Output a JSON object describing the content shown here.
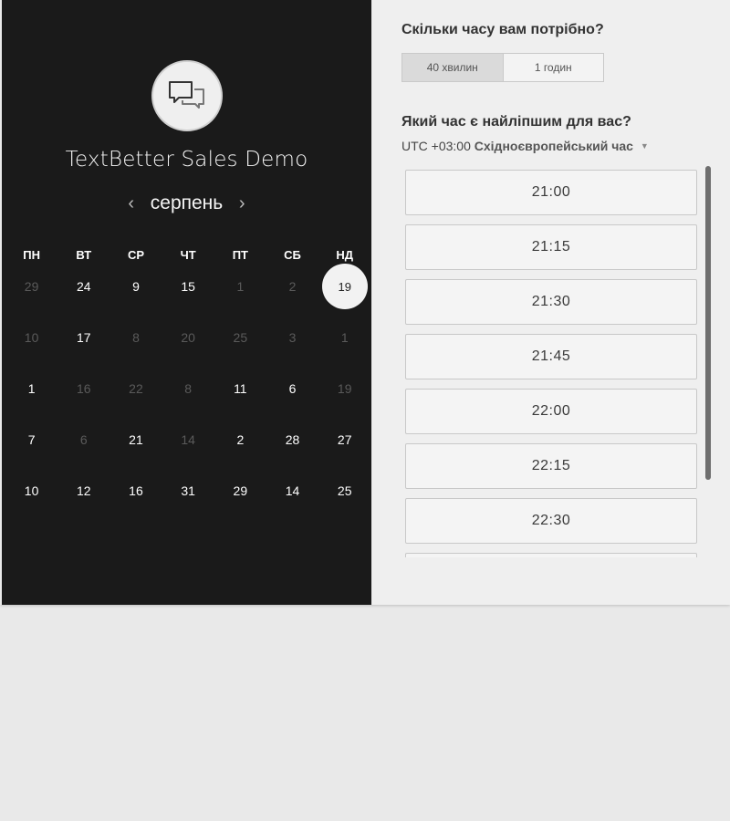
{
  "brand": {
    "name": "TextBetter Sales Demo",
    "logo_icon": "chat-bubbles-icon"
  },
  "calendar": {
    "month": "серпень",
    "prev_icon": "chevron-left-icon",
    "next_icon": "chevron-right-icon",
    "weekdays": [
      "ПН",
      "ВТ",
      "СР",
      "ЧТ",
      "ПТ",
      "СБ",
      "НД"
    ],
    "days": [
      {
        "d": "29",
        "on": false
      },
      {
        "d": "24",
        "on": true
      },
      {
        "d": "9",
        "on": true
      },
      {
        "d": "15",
        "on": true
      },
      {
        "d": "1",
        "on": false
      },
      {
        "d": "2",
        "on": false
      },
      {
        "d": "19",
        "on": true,
        "sel": true
      },
      {
        "d": "10",
        "on": false
      },
      {
        "d": "17",
        "on": true
      },
      {
        "d": "8",
        "on": false
      },
      {
        "d": "20",
        "on": false
      },
      {
        "d": "25",
        "on": false
      },
      {
        "d": "3",
        "on": false
      },
      {
        "d": "1",
        "on": false
      },
      {
        "d": "1",
        "on": true
      },
      {
        "d": "16",
        "on": false
      },
      {
        "d": "22",
        "on": false
      },
      {
        "d": "8",
        "on": false
      },
      {
        "d": "11",
        "on": true
      },
      {
        "d": "6",
        "on": true
      },
      {
        "d": "19",
        "on": false
      },
      {
        "d": "7",
        "on": true
      },
      {
        "d": "6",
        "on": false
      },
      {
        "d": "21",
        "on": true
      },
      {
        "d": "14",
        "on": false
      },
      {
        "d": "2",
        "on": true
      },
      {
        "d": "28",
        "on": true
      },
      {
        "d": "27",
        "on": true
      },
      {
        "d": "10",
        "on": true
      },
      {
        "d": "12",
        "on": true
      },
      {
        "d": "16",
        "on": true
      },
      {
        "d": "31",
        "on": true
      },
      {
        "d": "29",
        "on": true
      },
      {
        "d": "14",
        "on": true
      },
      {
        "d": "25",
        "on": true
      }
    ]
  },
  "duration": {
    "question": "Скільки часу вам потрібно?",
    "options": [
      "40 хвилин",
      "1 годин"
    ],
    "selected_index": 0
  },
  "time": {
    "question": "Який час є найліпшим для вас?",
    "tz_offset": "UTC +03:00",
    "tz_name": "Східноєвропейський час",
    "slots": [
      "21:00",
      "21:15",
      "21:30",
      "21:45",
      "22:00",
      "22:15",
      "22:30",
      ""
    ]
  },
  "colors": {
    "left_bg": "#1a1a1a",
    "right_bg": "#efefef",
    "page_bg": "#e9e9e9"
  }
}
